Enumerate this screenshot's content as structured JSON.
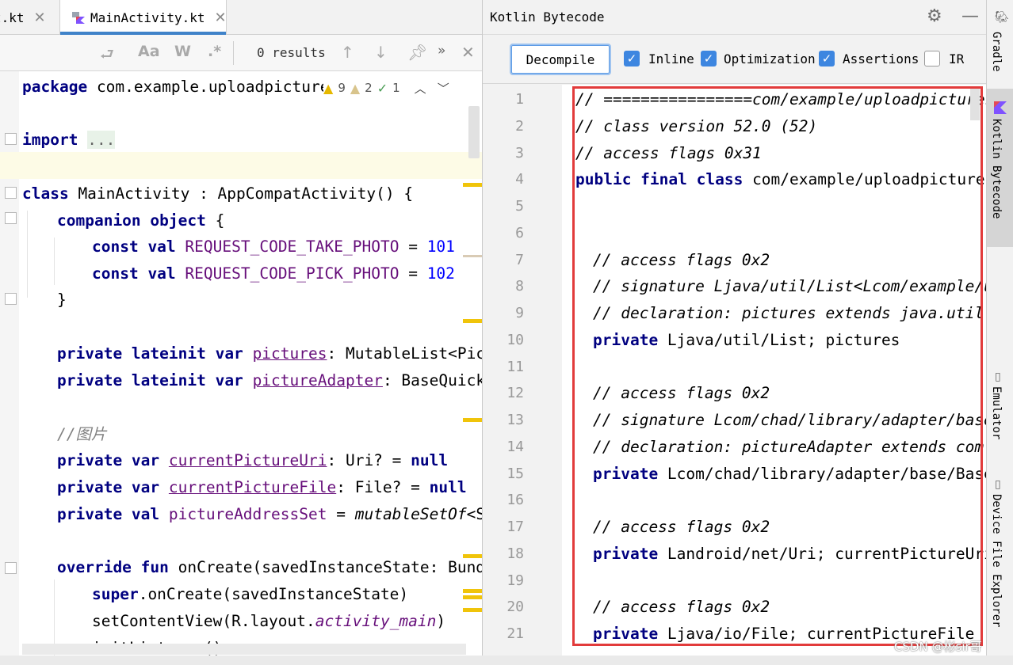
{
  "editor": {
    "tabs": [
      {
        "label": "t.kt"
      },
      {
        "label": "MainActivity.kt"
      }
    ],
    "search": {
      "results": "0 results"
    },
    "inspections": {
      "warnings": "9",
      "weak_warnings": "2",
      "ok": "1"
    },
    "lines": {
      "l1": "package com.example.uploadpicture",
      "l3_kw": "import",
      "l3_fold": "...",
      "l5_kw": "class",
      "l5_rest": " MainActivity : AppCompatActivity() {",
      "l6_kw": "companion object",
      "l6_rest": " {",
      "l7_kw": "const val",
      "l7_name": "REQUEST_CODE_TAKE_PHOTO",
      "l7_eq": " = ",
      "l7_num": "101",
      "l8_kw": "const val",
      "l8_name": "REQUEST_CODE_PICK_PHOTO",
      "l8_eq": " = ",
      "l8_num": "102",
      "l9": "}",
      "l11_kw": "private lateinit var",
      "l11_name": "pictures",
      "l11_rest": ": MutableList<Pic",
      "l12_kw": "private lateinit var",
      "l12_name": "pictureAdapter",
      "l12_rest": ": BaseQuick",
      "l14_cm": "//图片",
      "l15_kw": "private var",
      "l15_name": "currentPictureUri",
      "l15_rest": ": Uri? = ",
      "l15_null": "null",
      "l16_kw": "private var",
      "l16_name": "currentPictureFile",
      "l16_rest": ": File? = ",
      "l16_null": "null",
      "l17_kw": "private val",
      "l17_name": "pictureAddressSet",
      "l17_eq": " = ",
      "l17_fn": "mutableSetOf",
      "l17_rest": "<St",
      "l19_kw": "override fun",
      "l19_rest": " onCreate(savedInstanceState: Bundle",
      "l20_kw": "super",
      "l20_rest": ".onCreate(savedInstanceState)",
      "l21_a": "setContentView(R.layout.",
      "l21_b": "activity_main",
      "l21_c": ")",
      "l22": "initListener()"
    }
  },
  "bytecode": {
    "title": "Kotlin Bytecode",
    "decompile_label": "Decompile",
    "options": [
      {
        "label": "Inline",
        "checked": true
      },
      {
        "label": "Optimization",
        "checked": true
      },
      {
        "label": "Assertions",
        "checked": true
      },
      {
        "label": "IR",
        "checked": false
      }
    ],
    "line_numbers": [
      "1",
      "2",
      "3",
      "4",
      "5",
      "6",
      "7",
      "8",
      "9",
      "10",
      "11",
      "12",
      "13",
      "14",
      "15",
      "16",
      "17",
      "18",
      "19",
      "20",
      "21"
    ],
    "code": {
      "c1": "// ================com/example/uploadpictures/",
      "c2": "// class version 52.0 (52)",
      "c3": "// access flags 0x31",
      "c4_kw": "public final class",
      "c4_rest": " com/example/uploadpictures/",
      "c7": "// access flags 0x2",
      "c8": "// signature Ljava/util/List<Lcom/example/up",
      "c9": "// declaration: pictures extends java.util.Li",
      "c10_kw": "private",
      "c10_rest": " Ljava/util/List; pictures",
      "c12": "// access flags 0x2",
      "c13": "// signature Lcom/chad/library/adapter/base/B",
      "c14": "// declaration: pictureAdapter extends com.ch",
      "c15_kw": "private",
      "c15_rest": " Lcom/chad/library/adapter/base/BaseQu",
      "c17": "// access flags 0x2",
      "c18_kw": "private",
      "c18_rest": " Landroid/net/Uri; currentPictureUri",
      "c20": "// access flags 0x2",
      "c21_kw": "private",
      "c21_rest": " Ljava/io/File; currentPictureFile"
    }
  },
  "side_tools": [
    "Gradle",
    "Kotlin Bytecode",
    "Emulator",
    "Device File Explorer"
  ],
  "watermark": "CSDN @彬sir哥",
  "colors": {
    "accent": "#4083c9",
    "checkbox": "#3d86e0",
    "highlight_box": "#e23b3b",
    "keyword": "#000080",
    "constant": "#660e7a",
    "number": "#0000ff",
    "comment": "#808080"
  }
}
